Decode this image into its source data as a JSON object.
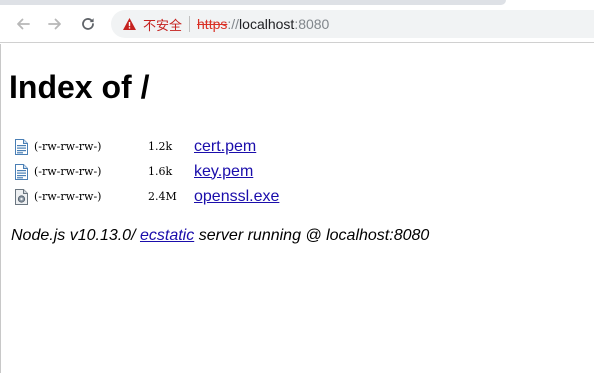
{
  "browser": {
    "security_label": "不安全",
    "url": {
      "scheme": "https",
      "separator": "://",
      "host": "localhost",
      "port": ":8080"
    },
    "colors": {
      "warning": "#c5221f",
      "link": "#1a0dab"
    }
  },
  "page": {
    "title": "Index of /",
    "files": [
      {
        "icon": "text-file-icon",
        "perms": "(-rw-rw-rw-)",
        "size": "1.2k",
        "name": "cert.pem"
      },
      {
        "icon": "text-file-icon",
        "perms": "(-rw-rw-rw-)",
        "size": "1.6k",
        "name": "key.pem"
      },
      {
        "icon": "executable-file-icon",
        "perms": "(-rw-rw-rw-)",
        "size": "2.4M",
        "name": "openssl.exe"
      }
    ],
    "footer": {
      "prefix": "Node.js v10.13.0/",
      "link": "ecstatic",
      "suffix": "server running @ localhost:8080"
    }
  }
}
